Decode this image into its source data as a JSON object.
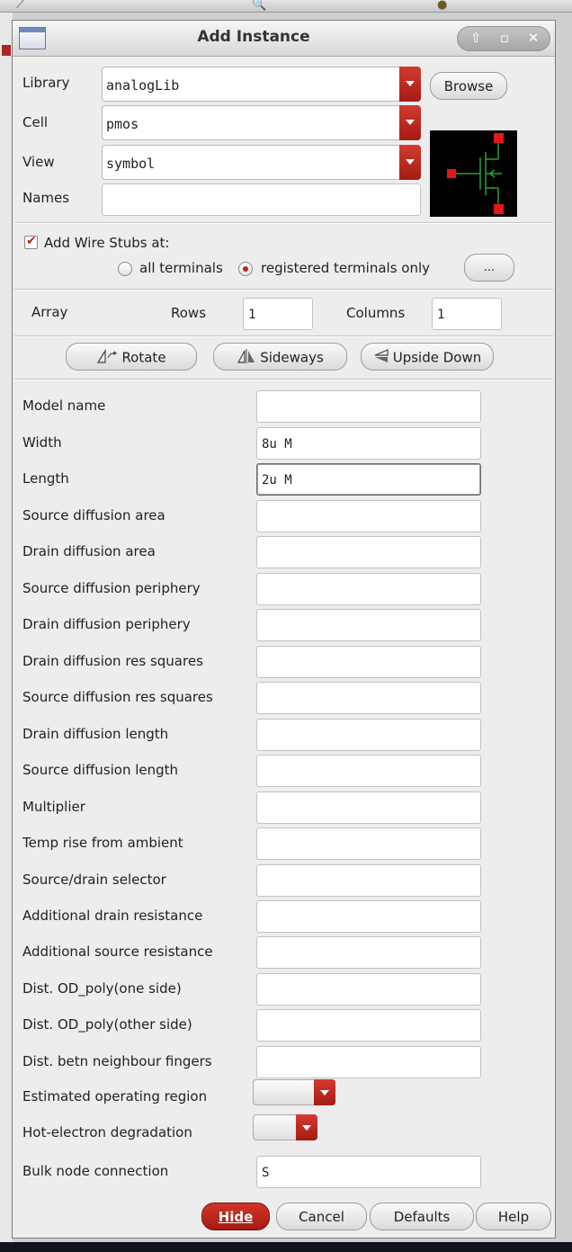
{
  "dialog": {
    "title": "Add Instance",
    "window_controls": [
      "up-arrow-icon",
      "maximize-icon",
      "close-icon"
    ]
  },
  "selection": {
    "library_label": "Library",
    "library_value": "analogLib",
    "browse_label": "Browse",
    "cell_label": "Cell",
    "cell_value": "pmos",
    "view_label": "View",
    "view_value": "symbol",
    "names_label": "Names",
    "names_value": ""
  },
  "wire_stubs": {
    "label": "Add Wire Stubs at:",
    "checked": true,
    "option_all": "all terminals",
    "option_registered": "registered terminals only",
    "selected": "registered terminals only",
    "more_label": "..."
  },
  "array": {
    "label": "Array",
    "rows_label": "Rows",
    "rows_value": "1",
    "columns_label": "Columns",
    "columns_value": "1"
  },
  "transform": {
    "rotate": "Rotate",
    "sideways": "Sideways",
    "upside_down": "Upside Down"
  },
  "params": [
    {
      "label": "Model name",
      "value": ""
    },
    {
      "label": "Width",
      "value": "8u M"
    },
    {
      "label": "Length",
      "value": "2u M"
    },
    {
      "label": "Source diffusion area",
      "value": ""
    },
    {
      "label": "Drain diffusion area",
      "value": ""
    },
    {
      "label": "Source diffusion periphery",
      "value": ""
    },
    {
      "label": "Drain diffusion periphery",
      "value": ""
    },
    {
      "label": "Drain diffusion res squares",
      "value": ""
    },
    {
      "label": "Source diffusion res squares",
      "value": ""
    },
    {
      "label": "Drain diffusion length",
      "value": ""
    },
    {
      "label": "Source diffusion length",
      "value": ""
    },
    {
      "label": "Multiplier",
      "value": ""
    },
    {
      "label": "Temp rise from ambient",
      "value": ""
    },
    {
      "label": "Source/drain selector",
      "value": ""
    },
    {
      "label": "Additional drain resistance",
      "value": ""
    },
    {
      "label": "Additional source resistance",
      "value": ""
    },
    {
      "label": "Dist. OD_poly(one side)",
      "value": ""
    },
    {
      "label": "Dist. OD_poly(other side)",
      "value": ""
    },
    {
      "label": "Dist. betn neighbour fingers",
      "value": ""
    }
  ],
  "dropdown_params": {
    "operating_region_label": "Estimated operating region",
    "hot_electron_label": "Hot-electron degradation"
  },
  "bulk": {
    "label": "Bulk node connection",
    "value": "S"
  },
  "footer": {
    "hide": "Hide",
    "cancel": "Cancel",
    "defaults": "Defaults",
    "help": "Help"
  },
  "colors": {
    "accent_red": "#c0241c",
    "preview_bg": "#000000",
    "preview_wire": "#2fa02f"
  }
}
